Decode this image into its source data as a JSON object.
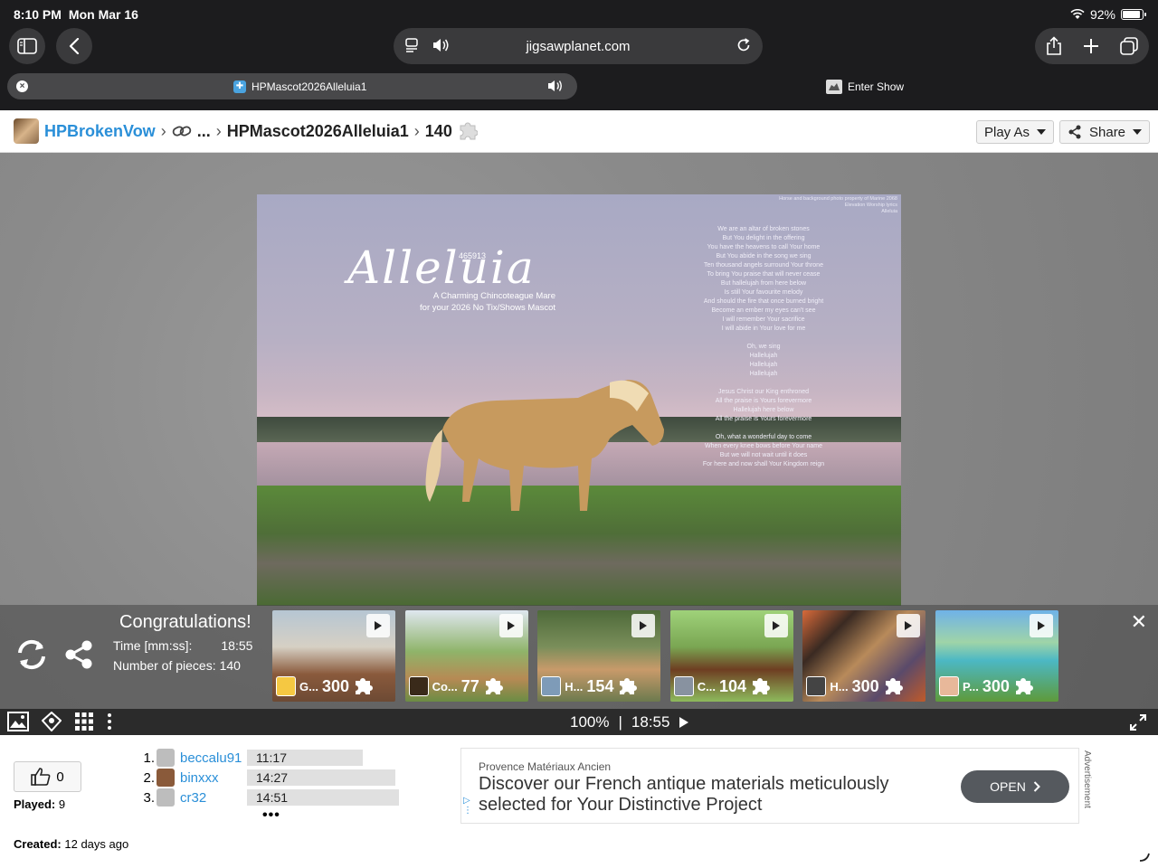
{
  "status": {
    "time": "8:10 PM",
    "date": "Mon Mar 16",
    "battery": "92%",
    "battery_level": 0.92
  },
  "browser": {
    "url": "jigsawplanet.com",
    "tab_title": "HPMascot2026Alleluia1",
    "enter_show": "Enter Show"
  },
  "breadcrumb": {
    "user": "HPBrokenVow",
    "ellipsis": "...",
    "puzzle": "HPMascot2026Alleluia1",
    "pieces": "140"
  },
  "header_buttons": {
    "play_as": "Play As",
    "share": "Share"
  },
  "puzzle_image": {
    "title": "Alleluia",
    "serial": "465913",
    "subtitle_1": "A Charming Chincoteague Mare",
    "subtitle_2": "for your 2026 No Tix/Shows Mascot",
    "credit_1": "Horse and background photo property of Marine 2068",
    "credit_2": "Elevation Worship lyrics",
    "credit_3": "Alleluia",
    "lyrics": [
      "We are an altar of broken stones",
      "But You delight in the offering",
      "You have the heavens to call Your home",
      "But You abide in the song we sing",
      "Ten thousand angels surround Your throne",
      "To bring You praise that will never cease",
      "But hallelujah from here below",
      "Is still Your favourite melody",
      "And should the fire that once burned bright",
      "Become an ember my eyes can't see",
      "I will remember Your sacrifice",
      "I will abide in Your love for me",
      "",
      "Oh, we sing",
      "Hallelujah",
      "Hallelujah",
      "Hallelujah",
      "",
      "Jesus Christ our King enthroned",
      "All the praise is Yours forevermore",
      "Hallelujah here below",
      "All the praise is Yours forevermore",
      "",
      "Oh, what a wonderful day to come",
      "When every knee bows before Your name",
      "But we will not wait until it does",
      "For here and now shall Your Kingdom reign"
    ]
  },
  "congrats": {
    "title": "Congratulations!",
    "time_label": "Time [mm:ss]:",
    "time_value": "18:55",
    "pieces_label": "Number of pieces:",
    "pieces_value": "140"
  },
  "suggestions": [
    {
      "name": "G...",
      "pieces": "300",
      "bg": "linear-gradient(to bottom,#b6c6d3 0%,#d6d0c4 40%,#8a5a3c 70%,#6d4a34 100%)",
      "av": "#f5c842"
    },
    {
      "name": "Co...",
      "pieces": "77",
      "bg": "linear-gradient(to bottom,#dfe7ef 0%,#8fb46a 45%,#b68a54 75%,#6a8c44 100%)",
      "av": "#3a2a1a"
    },
    {
      "name": "H...",
      "pieces": "154",
      "bg": "linear-gradient(to bottom,#4e6a3a 0%,#7a8e5a 40%,#c89a6a 65%,#6c7a4e 100%)",
      "av": "#7e9bb8"
    },
    {
      "name": "C...",
      "pieces": "104",
      "bg": "linear-gradient(to bottom,#9fd27a 0%,#7aa652 40%,#6e3e22 65%,#8dba5c 100%)",
      "av": "#8892a0"
    },
    {
      "name": "H...",
      "pieces": "300",
      "bg": "linear-gradient(135deg,#d86a3a 0%,#3a2a22 25%,#b88a5a 50%,#5a4a6a 75%,#c05a2a 100%)",
      "av": "#444"
    },
    {
      "name": "P...",
      "pieces": "300",
      "bg": "linear-gradient(to bottom,#6fb2e8 0%,#9fd4a8 35%,#4cb8c4 55%,#5e9a3a 100%)",
      "av": "#e8b89a"
    }
  ],
  "toolbar": {
    "zoom": "100%",
    "divider": "|",
    "time": "18:55"
  },
  "likes": {
    "count": "0"
  },
  "played": {
    "label": "Played:",
    "value": "9"
  },
  "created": {
    "label": "Created:",
    "value": "12 days ago"
  },
  "scores": [
    {
      "rank": "1.",
      "name": "beccalu91",
      "time": "11:17",
      "av": "#bdbdbd"
    },
    {
      "rank": "2.",
      "name": "binxxx",
      "time": "14:27",
      "av": "#8a5a3a"
    },
    {
      "rank": "3.",
      "name": "cr32",
      "time": "14:51",
      "av": "#bdbdbd"
    }
  ],
  "scores_more": "•••",
  "ad": {
    "brand": "Provence Matériaux Ancien",
    "text": "Discover our French antique materials meticulously selected for Your Distinctive Project",
    "button": "OPEN",
    "label": "Advertisement"
  }
}
